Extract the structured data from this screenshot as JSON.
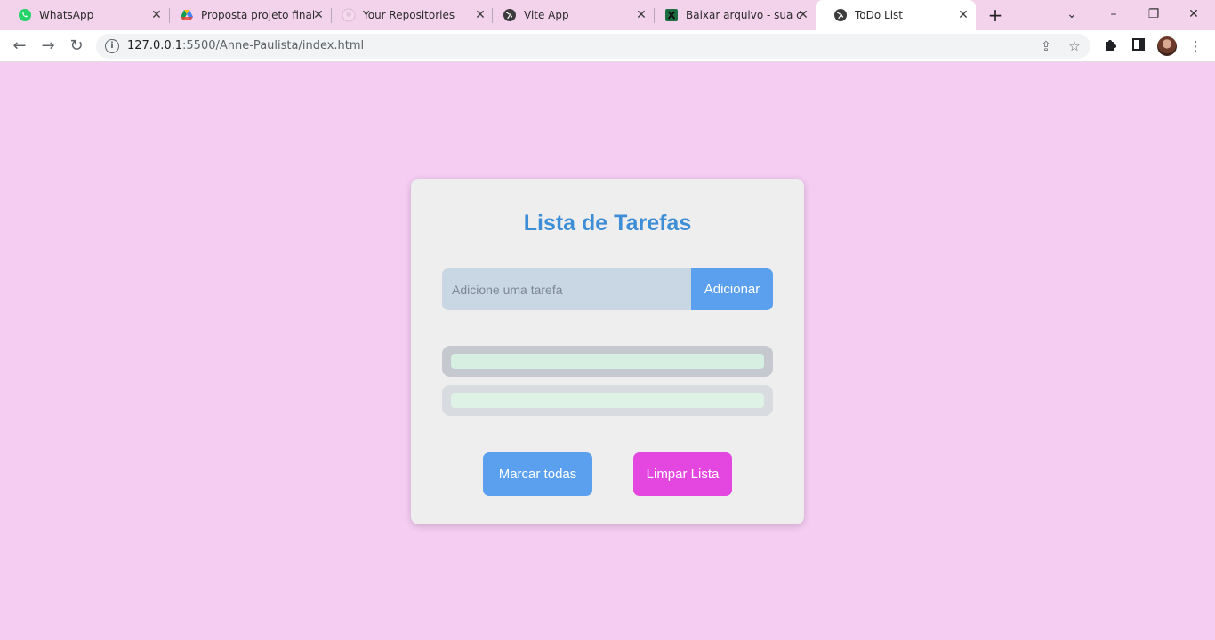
{
  "browser": {
    "tabs": [
      {
        "title": "WhatsApp",
        "icon": "whatsapp-icon",
        "active": false
      },
      {
        "title": "Proposta projeto final",
        "icon": "google-drive-icon",
        "active": false
      },
      {
        "title": "Your Repositories",
        "icon": "github-icon",
        "active": false
      },
      {
        "title": "Vite App",
        "icon": "globe-icon",
        "active": false
      },
      {
        "title": "Baixar arquivo - sua c",
        "icon": "excel-icon",
        "active": false
      },
      {
        "title": "ToDo List",
        "icon": "globe-icon",
        "active": true
      }
    ],
    "address_bar": {
      "host": "127.0.0.1",
      "path": ":5500/Anne-Paulista/index.html"
    }
  },
  "app": {
    "title": "Lista de Tarefas",
    "input_placeholder": "Adicione uma tarefa",
    "input_value": "",
    "add_label": "Adicionar",
    "mark_all_label": "Marcar todas",
    "clear_label": "Limpar Lista"
  },
  "colors": {
    "page_background": "#f5cdf3",
    "title": "#3d8ed6",
    "primary_button": "#5aa0ee",
    "clear_button": "#e447df"
  }
}
